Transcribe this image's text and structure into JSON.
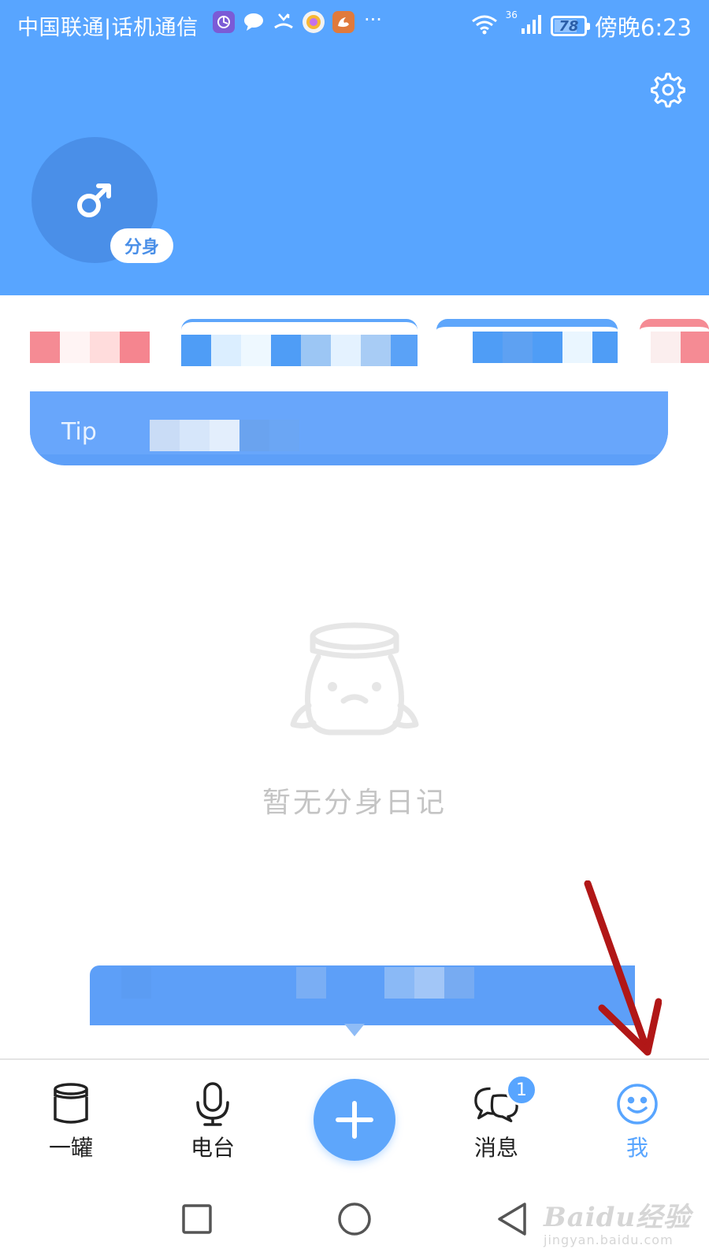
{
  "status_bar": {
    "carrier": "中国联通|话机通信",
    "network": "36",
    "battery": "78",
    "battery_level_percent": 78,
    "time": "傍晚6:23"
  },
  "header": {
    "settings_icon": "gear-icon",
    "avatar_icon": "male-symbol-icon",
    "clone_badge": "分身",
    "colors": {
      "header_bg": "#58a5ff",
      "avatar_bg": "#4a8fe8"
    }
  },
  "tip": {
    "label": "Tip"
  },
  "empty_state": {
    "icon": "sad-jar-icon",
    "message": "暂无分身日记"
  },
  "tabbar": {
    "tabs": [
      {
        "label": "一罐",
        "icon": "jar-icon"
      },
      {
        "label": "电台",
        "icon": "microphone-icon"
      },
      {
        "label": "消息",
        "icon": "chat-bubbles-icon",
        "badge": "1"
      },
      {
        "label": "我",
        "icon": "smiley-icon",
        "active": true
      }
    ],
    "add_icon": "plus-icon",
    "colors": {
      "active": "#58a5ff",
      "inactive": "#222222"
    }
  },
  "navbar": {
    "recent_icon": "square-icon",
    "home_icon": "circle-icon",
    "back_icon": "triangle-back-icon"
  },
  "watermark": {
    "logo": "Baidu经验",
    "url": "jingyan.baidu.com"
  }
}
